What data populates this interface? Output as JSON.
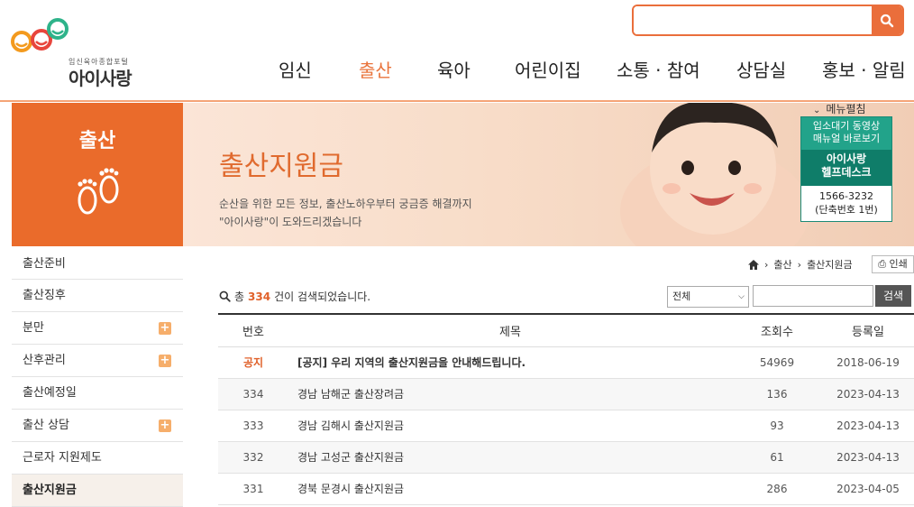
{
  "brand": {
    "tagline": "임신육아종합포털",
    "name": "아이사랑",
    "colors": {
      "accent": "#ea6b2b",
      "help_green": "#0f7d69"
    }
  },
  "search": {
    "placeholder": "",
    "icon": "search-icon"
  },
  "gnb": [
    {
      "label": "임신",
      "active": false
    },
    {
      "label": "출산",
      "active": true
    },
    {
      "label": "육아",
      "active": false
    },
    {
      "label": "어린이집",
      "active": false
    },
    {
      "label": "소통 · 참여",
      "active": false
    },
    {
      "label": "상담실",
      "active": false
    },
    {
      "label": "홍보 · 알림",
      "active": false
    }
  ],
  "sidebar": {
    "title": "출산",
    "icon": "footprints-icon",
    "items": [
      {
        "label": "출산준비",
        "expandable": false
      },
      {
        "label": "출산징후",
        "expandable": false
      },
      {
        "label": "분만",
        "expandable": true
      },
      {
        "label": "산후관리",
        "expandable": true
      },
      {
        "label": "출산예정일",
        "expandable": false
      },
      {
        "label": "출산 상담",
        "expandable": true
      },
      {
        "label": "근로자 지원제도",
        "expandable": false
      },
      {
        "label": "출산지원금",
        "expandable": false,
        "active": true
      }
    ]
  },
  "banner": {
    "title": "출산지원금",
    "desc_line1": "순산을 위한 모든 정보, 출산노하우부터 궁금증 해결까지",
    "desc_line2": "\"아이사랑\"이 도와드리겠습니다"
  },
  "menu_expand": "메뉴펼침",
  "helpdesk": {
    "video_line1": "입소대기 동영상",
    "video_line2": "매뉴얼 바로보기",
    "title_line1": "아이사랑",
    "title_line2": "헬프데스크",
    "phone": "1566-3232",
    "ext": "(단축번호 1번)"
  },
  "breadcrumb": {
    "level1": "출산",
    "level2": "출산지원금"
  },
  "print_label": "인쇄",
  "listing": {
    "prefix": "총",
    "count": "334",
    "suffix": "건이 검색되었습니다.",
    "filter_selected": "전체",
    "search_button": "검색"
  },
  "table": {
    "headers": {
      "no": "번호",
      "subject": "제목",
      "views": "조회수",
      "date": "등록일"
    },
    "rows": [
      {
        "no": "공지",
        "subject": "[공지] 우리 지역의 출산지원금을 안내해드립니다.",
        "views": "54969",
        "date": "2018-06-19",
        "notice": true
      },
      {
        "no": "334",
        "subject": "경남 남해군 출산장려금",
        "views": "136",
        "date": "2023-04-13"
      },
      {
        "no": "333",
        "subject": "경남 김해시 출산지원금",
        "views": "93",
        "date": "2023-04-13"
      },
      {
        "no": "332",
        "subject": "경남 고성군 출산지원금",
        "views": "61",
        "date": "2023-04-13"
      },
      {
        "no": "331",
        "subject": "경북 문경시 출산지원금",
        "views": "286",
        "date": "2023-04-05"
      }
    ]
  }
}
